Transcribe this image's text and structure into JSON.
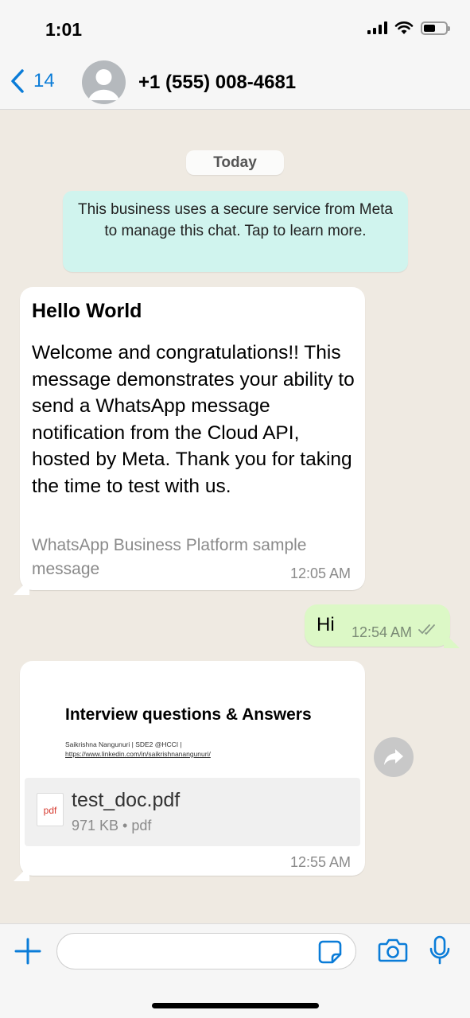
{
  "status_bar": {
    "time": "1:01"
  },
  "header": {
    "back_count": "14",
    "contact_name": "+1 (555) 008-4681"
  },
  "chat": {
    "date_chip": "Today",
    "system_notice": "This business uses a secure service from Meta to manage this chat. Tap to learn more.",
    "messages": [
      {
        "direction": "incoming",
        "title": "Hello World",
        "body": "Welcome and congratulations!! This message demonstrates your ability to send a WhatsApp message notification from the Cloud API, hosted by Meta. Thank you for taking the time to test with us.",
        "footer": "WhatsApp Business Platform sample message",
        "time": "12:05 AM"
      },
      {
        "direction": "outgoing",
        "text": "Hi",
        "time": "12:54 AM",
        "status": "read"
      },
      {
        "direction": "incoming",
        "type": "document",
        "preview_title": "Interview questions & Answers",
        "preview_author": "Saikrishna Nangunuri | SDE2 @HCCI |",
        "preview_link": "https://www.linkedin.com/in/saikrishnanangunuri/",
        "file_icon_label": "pdf",
        "file_name": "test_doc.pdf",
        "file_meta": "971 KB • pdf",
        "time": "12:55 AM"
      }
    ]
  },
  "input_bar": {
    "placeholder": ""
  },
  "colors": {
    "accent": "#0a7cd8",
    "incoming_bubble": "#ffffff",
    "outgoing_bubble": "#dcf8c6",
    "system_notice": "#d0f4ee",
    "chat_background": "#efeae2"
  },
  "icons": [
    "back-chevron-icon",
    "avatar-placeholder-icon",
    "double-check-icon",
    "forward-icon",
    "plus-icon",
    "sticker-icon",
    "camera-icon",
    "microphone-icon",
    "signal-icon",
    "wifi-icon",
    "battery-icon"
  ]
}
